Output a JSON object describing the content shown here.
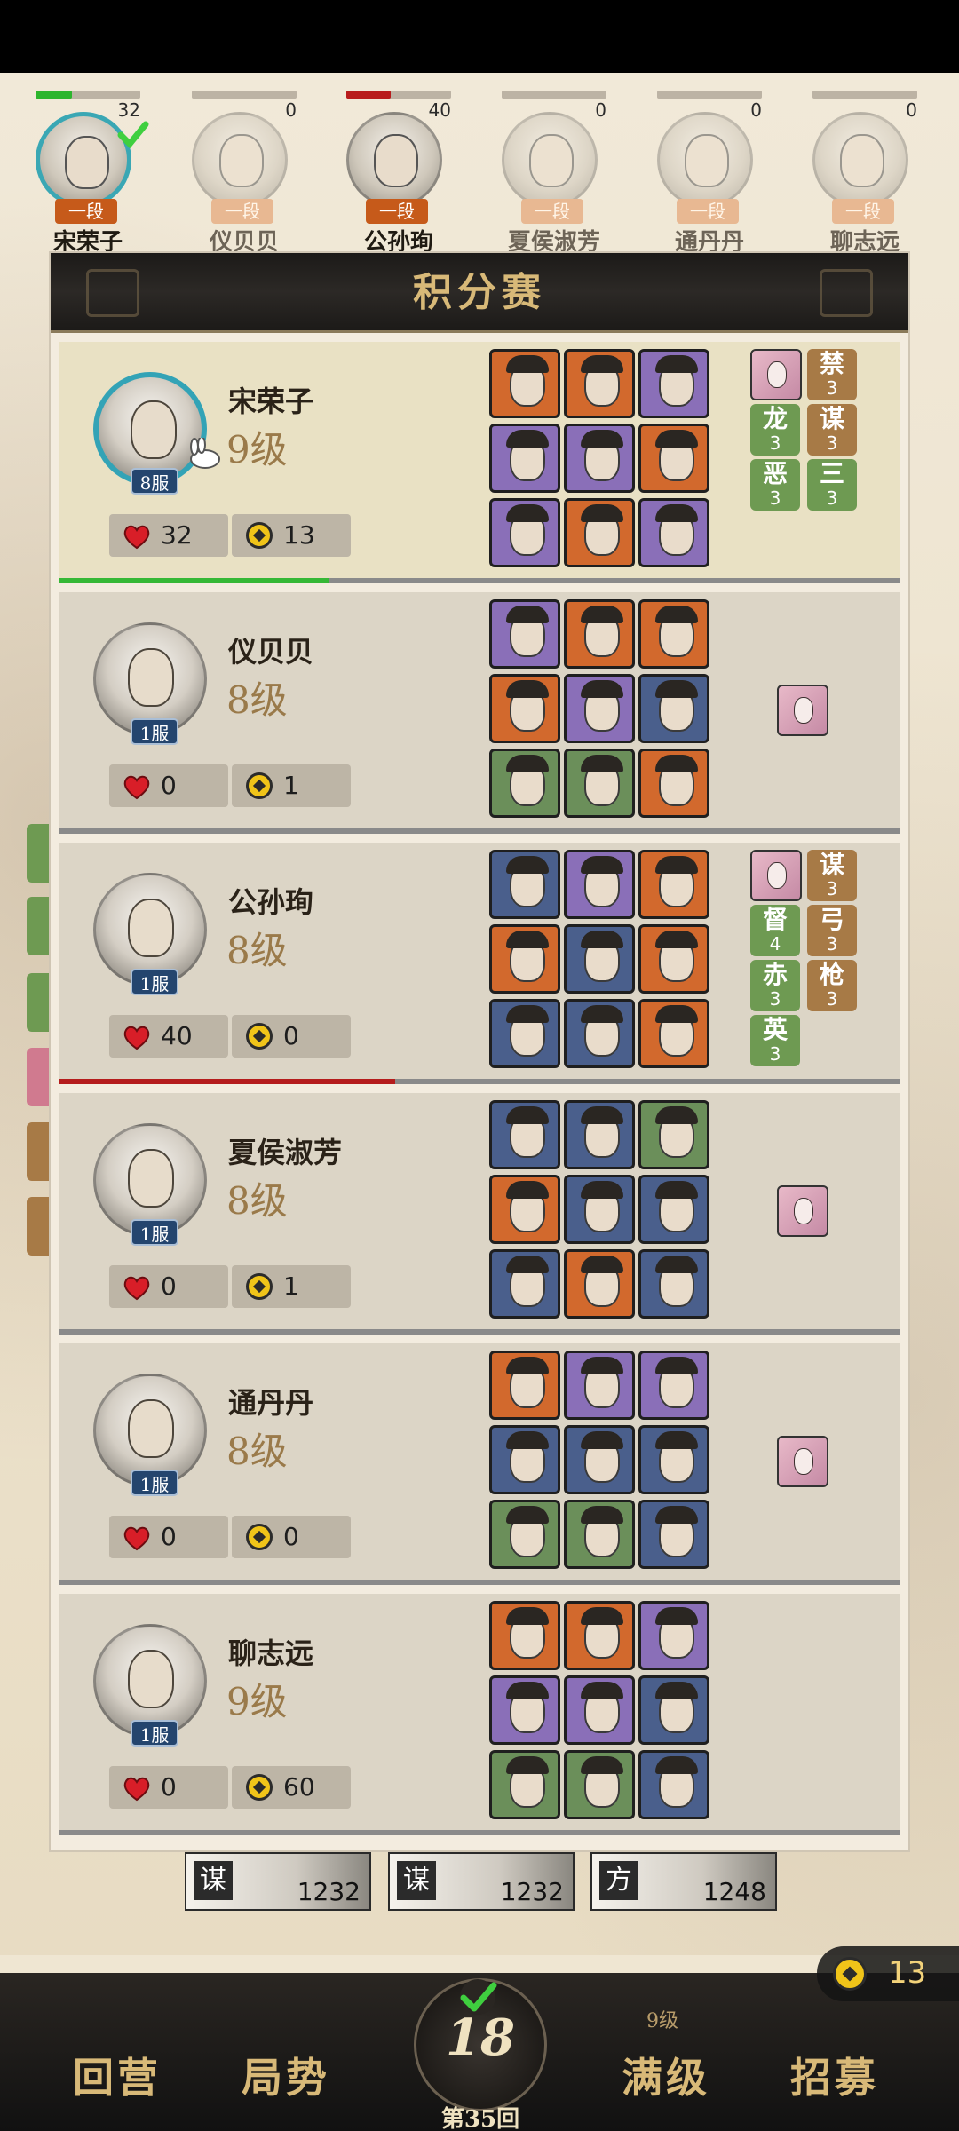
{
  "strip": [
    {
      "name": "宋荣子",
      "score": "32",
      "rank": "一段",
      "bar_pct": 35,
      "bar_color": "#2db52d",
      "active": true,
      "faded": false
    },
    {
      "name": "仪贝贝",
      "score": "0",
      "rank": "一段",
      "bar_pct": 0,
      "bar_color": "#2db52d",
      "active": false,
      "faded": true
    },
    {
      "name": "公孙珣",
      "score": "40",
      "rank": "一段",
      "bar_pct": 42,
      "bar_color": "#b81c1c",
      "active": false,
      "faded": false
    },
    {
      "name": "夏侯淑芳",
      "score": "0",
      "rank": "一段",
      "bar_pct": 0,
      "bar_color": "#2db52d",
      "active": false,
      "faded": true
    },
    {
      "name": "通丹丹",
      "score": "0",
      "rank": "一段",
      "bar_pct": 0,
      "bar_color": "#2db52d",
      "active": false,
      "faded": true
    },
    {
      "name": "聊志远",
      "score": "0",
      "rank": "一段",
      "bar_pct": 0,
      "bar_color": "#2db52d",
      "active": false,
      "faded": true
    }
  ],
  "panel": {
    "title": "积分赛"
  },
  "players": [
    {
      "name": "宋荣子",
      "level": "9级",
      "server": "8服",
      "hp": "32",
      "gold": "13",
      "self": true,
      "progress_pct": 32,
      "progress_color": "#36b836",
      "heroes": [
        "#d2692d",
        "#d2692d",
        "#8a6fb8",
        "#8a6fb8",
        "#8a6fb8",
        "#d2692d",
        "#8a6fb8",
        "#d2692d",
        "#8a6fb8"
      ],
      "beauty": true,
      "bonds": [
        {
          "name": "禁",
          "count": "3",
          "color": "brown"
        },
        {
          "name": "龙",
          "count": "3",
          "color": "green"
        },
        {
          "name": "谋",
          "count": "3",
          "color": "brown"
        },
        {
          "name": "恶",
          "count": "3",
          "color": "green"
        },
        {
          "name": "三",
          "count": "3",
          "color": "green"
        }
      ]
    },
    {
      "name": "仪贝贝",
      "level": "8级",
      "server": "1服",
      "hp": "0",
      "gold": "1",
      "self": false,
      "progress_pct": 0,
      "progress_color": "#36b836",
      "heroes": [
        "#8a6fb8",
        "#d2692d",
        "#d2692d",
        "#d2692d",
        "#8a6fb8",
        "#4a5f8c",
        "#6b8f5a",
        "#6b8f5a",
        "#d2692d"
      ],
      "beauty": true,
      "bonds": []
    },
    {
      "name": "公孙珣",
      "level": "8级",
      "server": "1服",
      "hp": "40",
      "gold": "0",
      "self": false,
      "progress_pct": 40,
      "progress_color": "#b51c1c",
      "heroes": [
        "#4a5f8c",
        "#8a6fb8",
        "#d2692d",
        "#d2692d",
        "#4a5f8c",
        "#d2692d",
        "#4a5f8c",
        "#4a5f8c",
        "#d2692d"
      ],
      "beauty": true,
      "bonds": [
        {
          "name": "谋",
          "count": "3",
          "color": "brown"
        },
        {
          "name": "督",
          "count": "4",
          "color": "green"
        },
        {
          "name": "弓",
          "count": "3",
          "color": "brown"
        },
        {
          "name": "赤",
          "count": "3",
          "color": "green"
        },
        {
          "name": "枪",
          "count": "3",
          "color": "brown"
        },
        {
          "name": "英",
          "count": "3",
          "color": "green"
        }
      ]
    },
    {
      "name": "夏侯淑芳",
      "level": "8级",
      "server": "1服",
      "hp": "0",
      "gold": "1",
      "self": false,
      "progress_pct": 0,
      "progress_color": "#36b836",
      "heroes": [
        "#4a5f8c",
        "#4a5f8c",
        "#6b8f5a",
        "#d2692d",
        "#4a5f8c",
        "#4a5f8c",
        "#4a5f8c",
        "#d2692d",
        "#4a5f8c"
      ],
      "beauty": true,
      "bonds": []
    },
    {
      "name": "通丹丹",
      "level": "8级",
      "server": "1服",
      "hp": "0",
      "gold": "0",
      "self": false,
      "progress_pct": 0,
      "progress_color": "#36b836",
      "heroes": [
        "#d2692d",
        "#8a6fb8",
        "#8a6fb8",
        "#4a5f8c",
        "#4a5f8c",
        "#4a5f8c",
        "#6b8f5a",
        "#6b8f5a",
        "#4a5f8c"
      ],
      "beauty": true,
      "bonds": []
    },
    {
      "name": "聊志远",
      "level": "9级",
      "server": "1服",
      "hp": "0",
      "gold": "60",
      "self": false,
      "progress_pct": 0,
      "progress_color": "#36b836",
      "heroes": [
        "#d2692d",
        "#d2692d",
        "#8a6fb8",
        "#8a6fb8",
        "#8a6fb8",
        "#4a5f8c",
        "#6b8f5a",
        "#6b8f5a",
        "#4a5f8c"
      ],
      "beauty": false,
      "bonds": []
    }
  ],
  "trophies": [
    {
      "tag": "谋",
      "value": "1232"
    },
    {
      "tag": "谋",
      "value": "1232"
    },
    {
      "tag": "方",
      "value": "1248"
    }
  ],
  "gold_total": "13",
  "nav": {
    "camp": "回营",
    "situation": "局势",
    "round_number": "18",
    "round_label": "第35回",
    "max_level": "满级",
    "max_level_note": "9级",
    "recruit": "招募"
  }
}
